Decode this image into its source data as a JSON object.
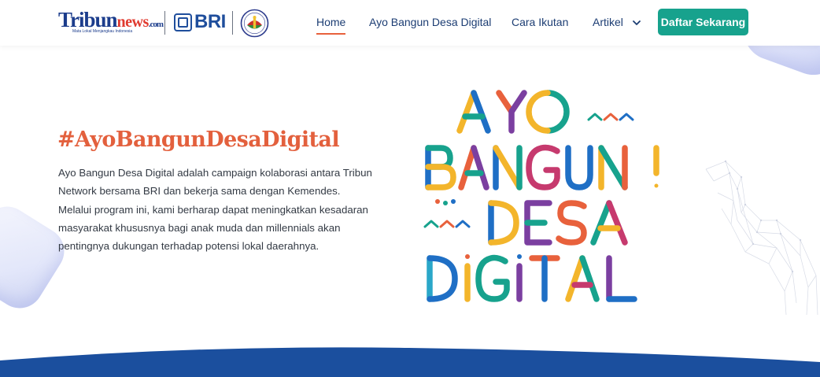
{
  "header": {
    "logos": {
      "tribun_brand": "Tribun",
      "tribun_suffix": "news",
      "tribun_dot": ".com",
      "tribun_tagline": "Mata Lokal Menjangkau Indonesia",
      "bri": "BRI",
      "kemendes_icon": "kemendes-emblem-icon"
    },
    "nav": {
      "home": "Home",
      "ayo": "Ayo Bangun Desa Digital",
      "cara": "Cara Ikutan",
      "artikel": "Artikel"
    },
    "cta": "Daftar Sekarang"
  },
  "hero": {
    "title": "#AyoBangunDesaDigital",
    "description": "Ayo Bangun Desa Digital adalah campaign kolaborasi antara Tribun Network bersama BRI dan bekerja sama dengan Kemendes. Melalui program ini, kami berharap dapat meningkatkan kesadaran masyarakat khususnya bagi anak muda dan millennials akan pentingnya dukungan terhadap potensi lokal daerahnya.",
    "art": {
      "line1": "AYO",
      "line2": "BANGUN",
      "line3": "DESA",
      "line4": "DIGITAL"
    }
  },
  "colors": {
    "accent_orange": "#e3603d",
    "cta_teal": "#17a28d",
    "nav_text": "#1c3d73",
    "wave_blue": "#1b4f9e",
    "art_palette": [
      "#1f6fc5",
      "#17a28d",
      "#f3b52b",
      "#e8613c",
      "#7b3fa0",
      "#c63a6e",
      "#2aa7c9"
    ]
  }
}
